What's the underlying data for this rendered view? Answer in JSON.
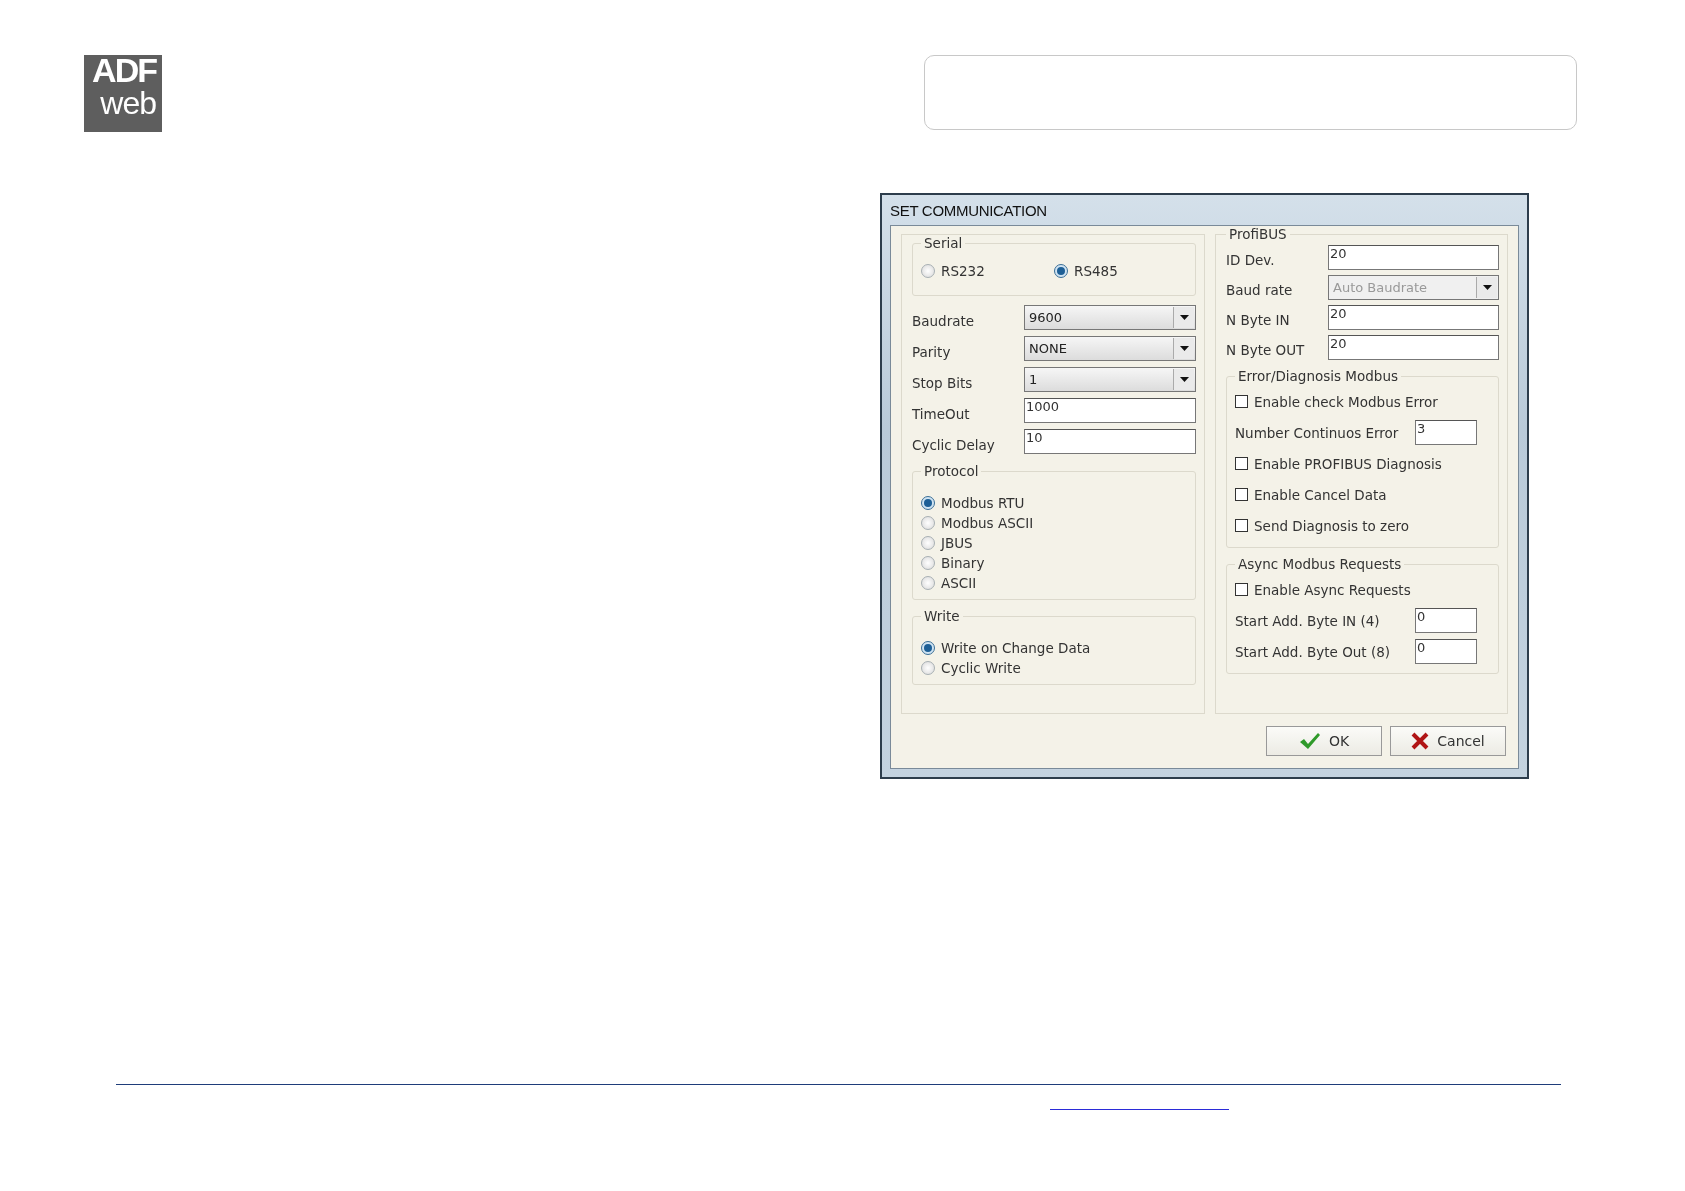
{
  "logo": {
    "line1": "ADF",
    "line2": "web"
  },
  "dialog": {
    "title": "SET COMMUNICATION",
    "serial": {
      "title": "Serial",
      "ports": [
        {
          "label": "RS232",
          "selected": false
        },
        {
          "label": "RS485",
          "selected": true
        }
      ],
      "fields": [
        {
          "label": "Baudrate",
          "kind": "select",
          "value": "9600",
          "disabled": false
        },
        {
          "label": "Parity",
          "kind": "select",
          "value": "NONE",
          "disabled": false
        },
        {
          "label": "Stop Bits",
          "kind": "select",
          "value": "1",
          "disabled": false
        },
        {
          "label": "TimeOut",
          "kind": "input",
          "value": "1000"
        },
        {
          "label": "Cyclic Delay",
          "kind": "input",
          "value": "10"
        }
      ]
    },
    "protocol": {
      "title": "Protocol",
      "options": [
        {
          "label": "Modbus RTU",
          "selected": true
        },
        {
          "label": "Modbus ASCII",
          "selected": false
        },
        {
          "label": "JBUS",
          "selected": false
        },
        {
          "label": "Binary",
          "selected": false
        },
        {
          "label": "ASCII",
          "selected": false
        }
      ]
    },
    "write": {
      "title": "Write",
      "options": [
        {
          "label": "Write on Change Data",
          "selected": true
        },
        {
          "label": "Cyclic Write",
          "selected": false
        }
      ]
    },
    "profibus": {
      "title": "ProfiBUS",
      "fields": [
        {
          "label": "ID Dev.",
          "kind": "input",
          "value": "20"
        },
        {
          "label": "Baud rate",
          "kind": "select",
          "value": "Auto Baudrate",
          "disabled": true
        },
        {
          "label": "N Byte IN",
          "kind": "input",
          "value": "20"
        },
        {
          "label": "N Byte OUT",
          "kind": "input",
          "value": "20"
        }
      ]
    },
    "error_diagnosis": {
      "title": "Error/Diagnosis Modbus",
      "items": [
        {
          "kind": "checkbox",
          "label": "Enable check Modbus Error",
          "checked": false
        },
        {
          "kind": "input",
          "label": "Number Continuos Error",
          "value": "3"
        },
        {
          "kind": "checkbox",
          "label": "Enable PROFIBUS Diagnosis",
          "checked": false
        },
        {
          "kind": "checkbox",
          "label": "Enable Cancel Data",
          "checked": false
        },
        {
          "kind": "checkbox",
          "label": "Send Diagnosis to zero",
          "checked": false
        }
      ]
    },
    "async_requests": {
      "title": "Async Modbus Requests",
      "items": [
        {
          "kind": "checkbox",
          "label": "Enable Async Requests",
          "checked": false
        },
        {
          "kind": "input",
          "label": "Start Add. Byte IN (4)",
          "value": "0"
        },
        {
          "kind": "input",
          "label": "Start Add. Byte Out (8)",
          "value": "0"
        }
      ]
    },
    "buttons": [
      {
        "kind": "ok",
        "label": "OK"
      },
      {
        "kind": "cancel",
        "label": "Cancel"
      }
    ]
  }
}
